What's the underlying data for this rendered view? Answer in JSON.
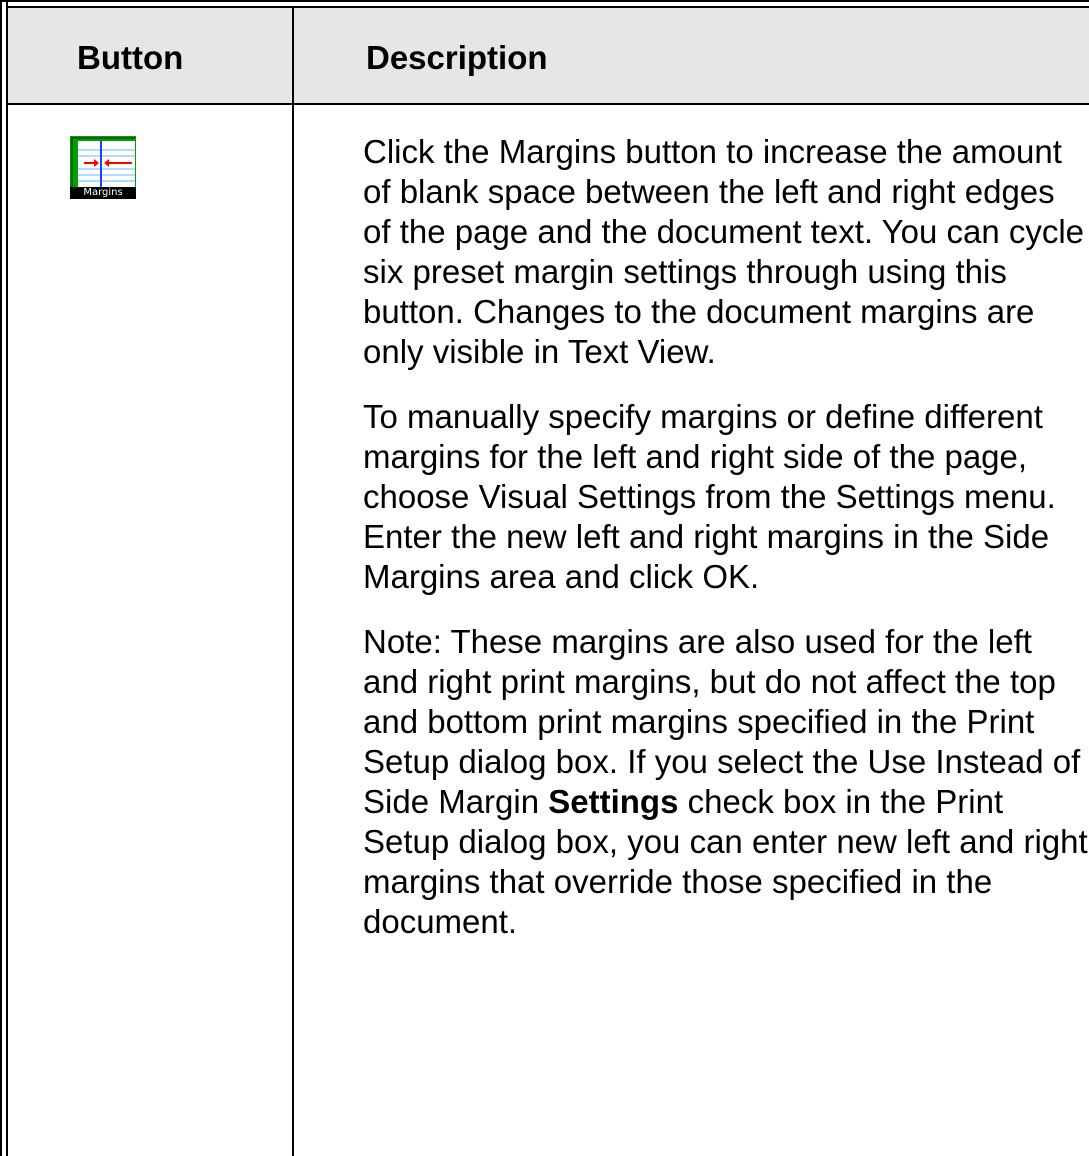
{
  "table": {
    "headers": {
      "button": "Button",
      "description": "Description"
    },
    "row": {
      "icon": {
        "name": "margins-icon",
        "label": "Margins",
        "colors": {
          "frame": "#00a000",
          "paper": "#ffffff",
          "lines": "#4aa0ff",
          "arrows": "#ff0000",
          "label_bg": "#000000"
        }
      },
      "paragraphs": [
        {
          "text": "Click the Margins button to increase the amount of blank space between the left and right edges of the page and the document text. You can cycle six preset margin settings through using this button. Changes to the document margins are only visible in Text View."
        },
        {
          "text": "To manually specify margins or define different margins for the left and right side of the page, choose Visual Settings from the Settings menu. Enter the new left and right margins in the Side Margins area and click OK."
        },
        {
          "text_before": "Note: These margins are also used for the left and right print margins, but do not affect the top and bottom print margins specified in the Print Setup dialog box. If you select the Use Instead of Side Margin ",
          "bold": "Settings",
          "text_after": " check box in the Print Setup dialog box, you can enter new left and right margins that override those specified in the document."
        }
      ]
    }
  },
  "colors": {
    "header_bg": "#e6e6e6",
    "border": "#000000"
  }
}
